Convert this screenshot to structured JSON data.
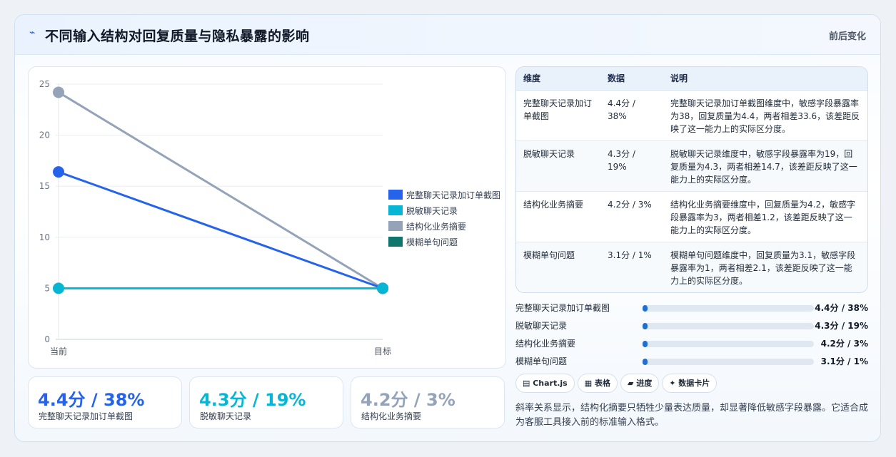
{
  "header": {
    "icon": "bolt-icon",
    "title": "不同输入结构对回复质量与隐私暴露的影响",
    "tag": "前后变化"
  },
  "chart_data": {
    "type": "line",
    "x": [
      "当前",
      "目标"
    ],
    "ylim": [
      0,
      25
    ],
    "yticks": [
      0,
      5,
      10,
      15,
      20,
      25
    ],
    "grid": true,
    "legend_position": "right",
    "series": [
      {
        "name": "完整聊天记录加订单截图",
        "values": [
          16.4,
          5
        ],
        "color": "#2563eb"
      },
      {
        "name": "脱敏聊天记录",
        "values": [
          5,
          5
        ],
        "color": "#06b6d4"
      },
      {
        "name": "结构化业务摘要",
        "values": [
          24.2,
          5
        ],
        "color": "#94a3b8"
      },
      {
        "name": "模糊单句问题",
        "values": [
          null,
          null
        ],
        "color": "#0f766e"
      }
    ]
  },
  "stats": [
    {
      "value": "4.4分 / 38%",
      "label": "完整聊天记录加订单截图",
      "color": "#2563eb"
    },
    {
      "value": "4.3分 / 19%",
      "label": "脱敏聊天记录",
      "color": "#06b6d4"
    },
    {
      "value": "4.2分 / 3%",
      "label": "结构化业务摘要",
      "color": "#94a3b8"
    }
  ],
  "table": {
    "headers": [
      "维度",
      "数据",
      "说明"
    ],
    "rows": [
      [
        "完整聊天记录加订单截图",
        "4.4分 / 38%",
        "完整聊天记录加订单截图维度中，敏感字段暴露率为38，回复质量为4.4，两者相差33.6，该差距反映了这一能力上的实际区分度。"
      ],
      [
        "脱敏聊天记录",
        "4.3分 / 19%",
        "脱敏聊天记录维度中，敏感字段暴露率为19，回复质量为4.3，两者相差14.7，该差距反映了这一能力上的实际区分度。"
      ],
      [
        "结构化业务摘要",
        "4.2分 / 3%",
        "结构化业务摘要维度中，回复质量为4.2，敏感字段暴露率为3，两者相差1.2，该差距反映了这一能力上的实际区分度。"
      ],
      [
        "模糊单句问题",
        "3.1分 / 1%",
        "模糊单句问题维度中，回复质量为3.1，敏感字段暴露率为1，两者相差2.1，该差距反映了这一能力上的实际区分度。"
      ]
    ]
  },
  "progress": [
    {
      "label": "完整聊天记录加订单截图",
      "value": "4.4分 / 38%",
      "fraction": 0.03
    },
    {
      "label": "脱敏聊天记录",
      "value": "4.3分 / 19%",
      "fraction": 0.03
    },
    {
      "label": "结构化业务摘要",
      "value": "4.2分 / 3%",
      "fraction": 0.03
    },
    {
      "label": "模糊单句问题",
      "value": "3.1分 / 1%",
      "fraction": 0.03
    }
  ],
  "chips": [
    "▤ Chart.js",
    "▦ 表格",
    "▰ 进度",
    "✦ 数据卡片"
  ],
  "note": "斜率关系显示，结构化摘要只牺牲少量表达质量，却显著降低敏感字段暴露。它适合成为客服工具接入前的标准输入格式。"
}
